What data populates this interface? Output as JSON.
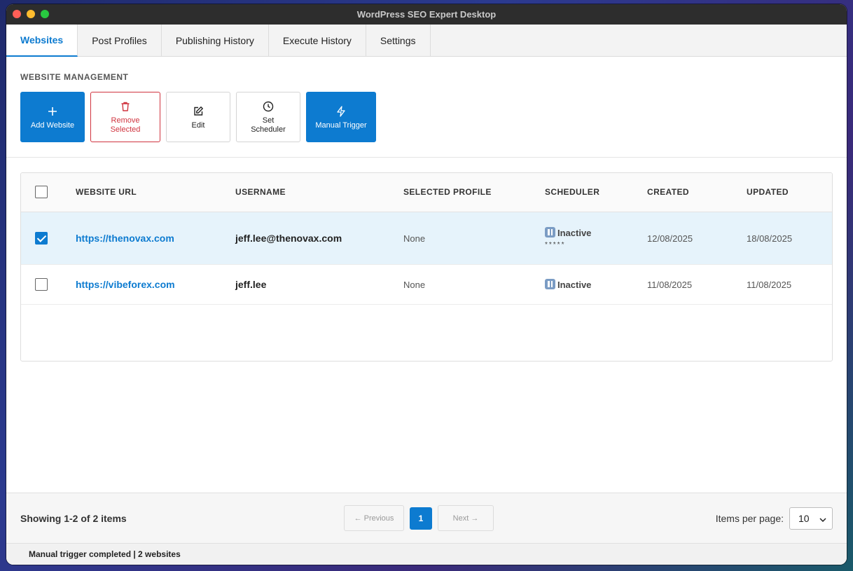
{
  "window": {
    "title": "WordPress SEO Expert Desktop"
  },
  "tabs": [
    {
      "label": "Websites",
      "active": true
    },
    {
      "label": "Post Profiles"
    },
    {
      "label": "Publishing History"
    },
    {
      "label": "Execute History"
    },
    {
      "label": "Settings"
    }
  ],
  "management": {
    "section_label": "WEBSITE MANAGEMENT",
    "buttons": {
      "add": {
        "label": "Add Website",
        "icon": "plus-icon"
      },
      "remove": {
        "label": "Remove Selected",
        "icon": "trash-icon"
      },
      "edit": {
        "label": "Edit",
        "icon": "edit-icon"
      },
      "scheduler": {
        "label": "Set Scheduler",
        "icon": "clock-icon"
      },
      "trigger": {
        "label": "Manual Trigger",
        "icon": "lightning-icon"
      }
    }
  },
  "table": {
    "headers": {
      "url": "WEBSITE URL",
      "username": "USERNAME",
      "profile": "SELECTED PROFILE",
      "scheduler": "SCHEDULER",
      "created": "CREATED",
      "updated": "UPDATED"
    },
    "rows": [
      {
        "checked": true,
        "url": "https://thenovax.com",
        "username": "jeff.lee@thenovax.com",
        "profile": "None",
        "scheduler": "Inactive",
        "scheduler_detail": "*****",
        "created": "12/08/2025",
        "updated": "18/08/2025"
      },
      {
        "checked": false,
        "url": "https://vibeforex.com",
        "username": "jeff.lee",
        "profile": "None",
        "scheduler": "Inactive",
        "created": "11/08/2025",
        "updated": "11/08/2025"
      }
    ]
  },
  "footer": {
    "showing": "Showing 1-2 of 2 items",
    "prev_label": "← Previous",
    "current_page": "1",
    "next_label": "Next →",
    "per_page_label": "Items per page:",
    "per_page_value": "10"
  },
  "status": {
    "message": "Manual trigger completed | 2 websites"
  },
  "colors": {
    "accent": "#0d7bd0",
    "danger": "#d0343f",
    "selected_row": "#e6f3fb"
  }
}
